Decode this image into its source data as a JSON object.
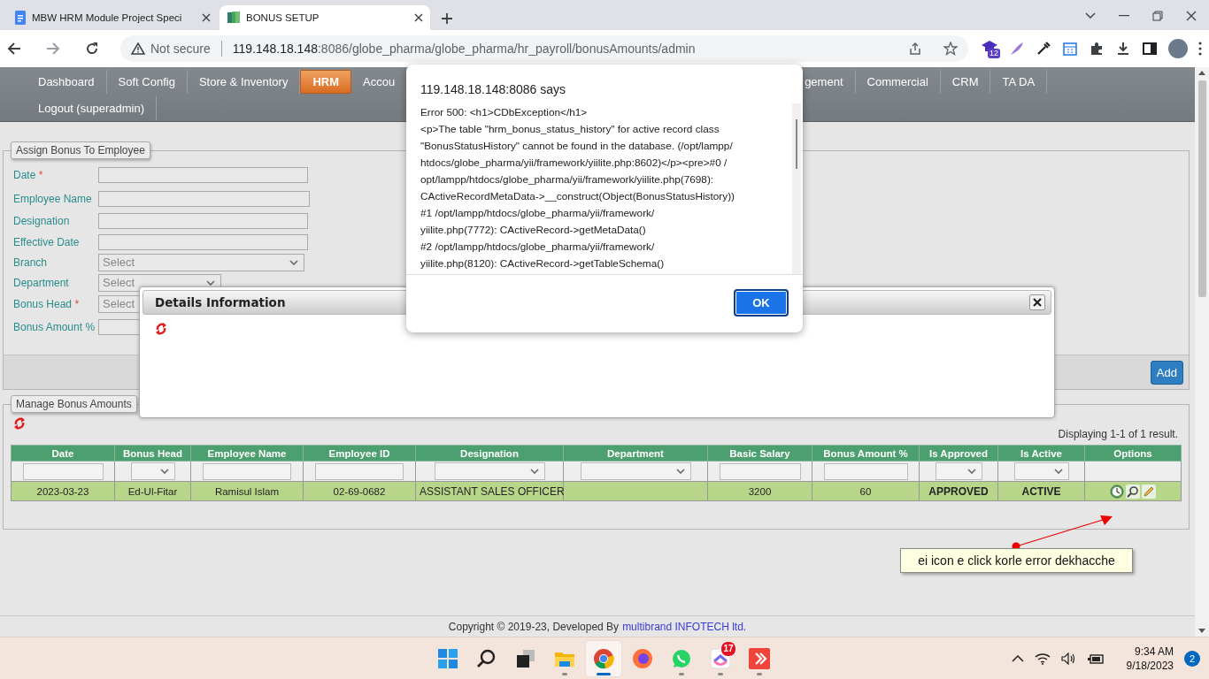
{
  "browser": {
    "tabs": [
      {
        "title": "MBW HRM Module Project Speci",
        "kind": "doc",
        "selected": false
      },
      {
        "title": "BONUS SETUP",
        "kind": "site",
        "selected": true
      }
    ],
    "security": "Not secure",
    "url_host": "119.148.18.148",
    "url_rest": ":8086/globe_pharma/globe_pharma/hr_payroll/bonusAmounts/admin",
    "extension_badge": "12"
  },
  "nav": {
    "rows": [
      {
        "items": [
          {
            "label": "Dashboard",
            "selected": false
          },
          {
            "label": "Soft Config",
            "selected": false
          },
          {
            "label": "Store & Inventory",
            "selected": false
          },
          {
            "label": "HRM",
            "selected": true
          },
          {
            "label": "Accou",
            "selected": false
          },
          {
            "label": "gement",
            "selected": false
          },
          {
            "label": "Commercial",
            "selected": false
          },
          {
            "label": "CRM",
            "selected": false
          },
          {
            "label": "TA DA",
            "selected": false
          }
        ]
      },
      {
        "items": [
          {
            "label": "Logout (superadmin)",
            "selected": false
          }
        ]
      }
    ]
  },
  "form": {
    "legend": "Assign Bonus To Employee",
    "fields": [
      {
        "label": "Date",
        "mark": "*",
        "kind": "text"
      },
      {
        "label": "Employee Name",
        "kind": "text"
      },
      {
        "label": "Designation",
        "kind": "text"
      },
      {
        "label": "Effective Date",
        "kind": "text"
      },
      {
        "label": "Branch",
        "kind": "select",
        "value": "Select"
      },
      {
        "label": "Department",
        "kind": "select",
        "value": "Select"
      },
      {
        "label": "Bonus Head",
        "mark": "*",
        "kind": "select",
        "value": "Select"
      },
      {
        "label": "Bonus Amount %",
        "kind": "text"
      }
    ],
    "button": "Add"
  },
  "grid": {
    "legend": "Manage Bonus Amounts",
    "summary": "Displaying 1-1 of 1 result.",
    "columns": [
      {
        "title": "Date",
        "kind": "text"
      },
      {
        "title": "Bonus Head",
        "kind": "select"
      },
      {
        "title": "Employee Name",
        "kind": "text"
      },
      {
        "title": "Employee ID",
        "kind": "text"
      },
      {
        "title": "Designation",
        "kind": "select"
      },
      {
        "title": "Department",
        "kind": "select"
      },
      {
        "title": "Basic Salary",
        "kind": "text"
      },
      {
        "title": "Bonus Amount %",
        "kind": "text"
      },
      {
        "title": "Is Approved",
        "kind": "select"
      },
      {
        "title": "Is Active",
        "kind": "select"
      },
      {
        "title": "Options",
        "kind": "none"
      }
    ],
    "rows": [
      {
        "cells": [
          {
            "kind": "text",
            "text": "2023-03-23"
          },
          {
            "kind": "text",
            "text": "Ed-Ul-Fitar"
          },
          {
            "kind": "text",
            "text": "Ramisul Islam"
          },
          {
            "kind": "text",
            "text": "02-69-0682"
          },
          {
            "kind": "left",
            "text": "ASSISTANT SALES OFFICER"
          },
          {
            "kind": "empty"
          },
          {
            "kind": "text",
            "text": "3200"
          },
          {
            "kind": "text",
            "text": "60"
          },
          {
            "kind": "status",
            "text": "APPROVED"
          },
          {
            "kind": "status",
            "text": "ACTIVE"
          },
          {
            "kind": "actions"
          }
        ]
      }
    ]
  },
  "details_modal": {
    "title": "Details Information"
  },
  "alert": {
    "title": "119.148.18.148:8086 says",
    "message": "Error 500: <h1>CDbException</h1>\n<p>The table \"hrm_bonus_status_history\" for active record class\n\"BonusStatusHistory\" cannot be found in the database. (/opt/lampp/\nhtdocs/globe_pharma/yii/framework/yiilite.php:8602)</p><pre>#0 /\nopt/lampp/htdocs/globe_pharma/yii/framework/yiilite.php(7698):\nCActiveRecordMetaData->__construct(Object(BonusStatusHistory))\n#1 /opt/lampp/htdocs/globe_pharma/yii/framework/\nyiilite.php(7772): CActiveRecord->getMetaData()\n#2 /opt/lampp/htdocs/globe_pharma/yii/framework/\nyiilite.php(8120): CActiveRecord->getTableSchema()",
    "button": "OK"
  },
  "annotation": {
    "text": "ei icon e click korle error dekhacche"
  },
  "footer": {
    "text": "Copyright © 2019-23, Developed By",
    "link": "multibrand INFOTECH ltd."
  },
  "taskbar": {
    "apps": [
      {
        "kind": "start",
        "running": false,
        "selected": false
      },
      {
        "kind": "search",
        "running": false,
        "selected": false
      },
      {
        "kind": "taskview",
        "running": false,
        "selected": false
      },
      {
        "kind": "explorer",
        "running": true,
        "selected": false
      },
      {
        "kind": "chrome",
        "running": true,
        "selected": true
      },
      {
        "kind": "firefox",
        "running": false,
        "selected": false
      },
      {
        "kind": "whatsapp",
        "running": true,
        "selected": false
      },
      {
        "kind": "clickup",
        "running": true,
        "selected": false,
        "badge": "17"
      },
      {
        "kind": "anydesk",
        "running": true,
        "selected": false
      }
    ],
    "time": "9:34 AM",
    "date": "9/18/2023",
    "notifications": "2"
  }
}
